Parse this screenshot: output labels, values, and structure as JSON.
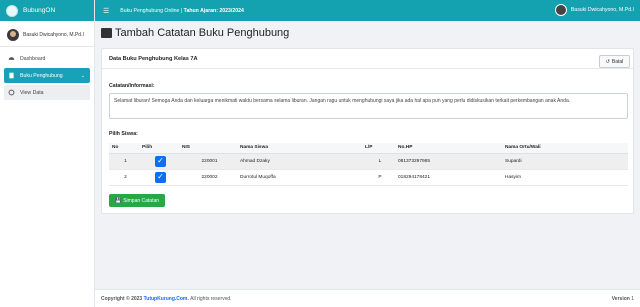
{
  "app": {
    "brand": "BubungON",
    "top_title_prefix": "Buku Penghubung Online |",
    "top_title_bold": "Tahun Ajaran: 2023/2024",
    "user_name": "Basuki Dwicahyono, M.Pd.I"
  },
  "sidebar": {
    "user_name": "Basuki Dwicahyono, M.Pd.I",
    "items": [
      {
        "label": "Dashboard"
      },
      {
        "label": "Buku Penghubung"
      },
      {
        "label": "View Data"
      }
    ]
  },
  "page": {
    "title": "Tambah Catatan Buku Penghubung",
    "card_title": "Data Buku Penghubung Kelas 7A",
    "back_label": "Batal",
    "notes_label": "Catatan/Informasi:",
    "notes_value": "Selamat liburan! Semoga Anda dan keluarga menikmati waktu bersama selama liburan. Jangan ragu untuk menghubungi saya jika ada hal apa pun yang perlu didiskusikan terkait perkembangan anak Anda.",
    "students_label": "Pilih Siswa:",
    "save_label": "Simpan Catatan"
  },
  "table": {
    "headers": [
      "No",
      "Pilih",
      "NIS",
      "Nama Siswa",
      "L/P",
      "No.HP",
      "Nama Ortu/Wali"
    ],
    "rows": [
      {
        "no": "1",
        "nis": "220001",
        "name": "Ahmad Dzaky",
        "lp": "L",
        "hp": "081373297985",
        "parent": "Supardi",
        "checked": true
      },
      {
        "no": "2",
        "nis": "220002",
        "name": "Durrotul Muqoffa",
        "lp": "P",
        "hp": "018294178421",
        "parent": "Hasyim",
        "checked": true
      }
    ]
  },
  "footer": {
    "prefix": "Copyright © 2023",
    "link": "TutupKurung.Com.",
    "suffix": "All rights reserved.",
    "version_label": "Version",
    "version_value": "1"
  },
  "colors": {
    "accent": "#14a2b0",
    "save": "#28a745",
    "checkbox": "#0d6efd"
  }
}
